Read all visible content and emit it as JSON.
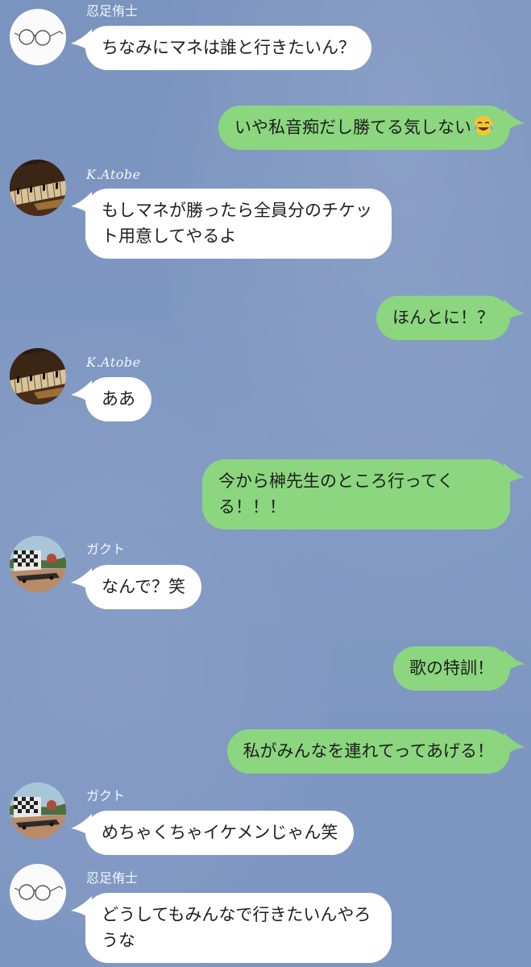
{
  "chat": {
    "messages": [
      {
        "sender": "忍足侑士",
        "text": "ちなみにマネは誰と行きたいん？"
      },
      {
        "text": "いや私音痴だし勝てる気しない",
        "emoji": "face-with-tears-of-joy"
      },
      {
        "sender": "K.Atobe",
        "text": "もしマネが勝ったら全員分のチケット用意してやるよ"
      },
      {
        "text": "ほんとに！？"
      },
      {
        "sender": "K.Atobe",
        "text": "ああ"
      },
      {
        "text": "今から榊先生のところ行ってくる！！！"
      },
      {
        "sender": "ガクト",
        "text": "なんで？笑"
      },
      {
        "text": "歌の特訓！"
      },
      {
        "text": "私がみんなを連れてってあげる！"
      },
      {
        "sender": "ガクト",
        "text": "めちゃくちゃイケメンじゃん笑"
      },
      {
        "sender": "忍足侑士",
        "text": "どうしてもみんなで行きたいんやろうな"
      }
    ]
  },
  "colors": {
    "background": "#7f97c1",
    "incoming_bubble": "#ffffff",
    "outgoing_bubble": "#8bd67f",
    "sender_text": "#f4f6fb"
  },
  "icons": {
    "avatar_oshitari": "glasses-avatar",
    "avatar_atobe": "piano-avatar",
    "avatar_gakuto": "outdoor-photo-avatar"
  }
}
